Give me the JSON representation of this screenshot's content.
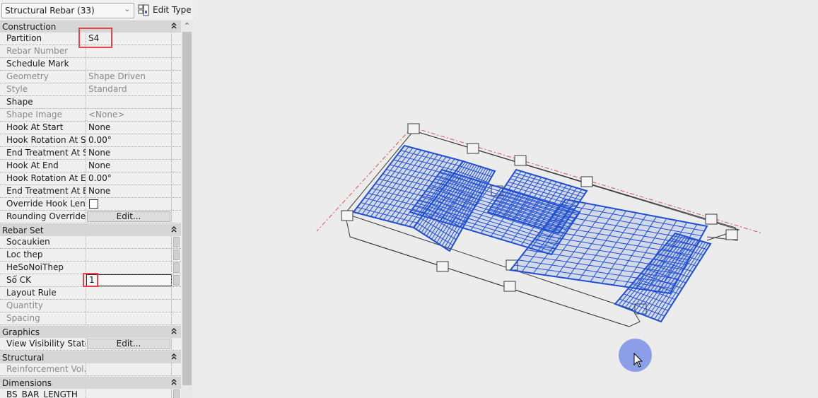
{
  "properties_panel": {
    "type_selector": {
      "value": "Structural Rebar (33)",
      "icon": "chevron-down-icon"
    },
    "edit_type": {
      "label": "Edit Type",
      "icon": "edit-type-icon"
    },
    "groups": [
      {
        "title": "Construction",
        "rows": [
          {
            "name": "Partition",
            "value": "S4",
            "dim": false,
            "highlighted": true
          },
          {
            "name": "Rebar Number",
            "value": "",
            "dim": true
          },
          {
            "name": "Schedule Mark",
            "value": "",
            "dim": false
          },
          {
            "name": "Geometry",
            "value": "Shape Driven",
            "dim": true
          },
          {
            "name": "Style",
            "value": "Standard",
            "dim": true
          },
          {
            "name": "Shape",
            "value": "",
            "dim": false
          },
          {
            "name": "Shape Image",
            "value": "<None>",
            "dim": true
          },
          {
            "name": "Hook At Start",
            "value": "None",
            "dim": false
          },
          {
            "name": "Hook Rotation At S...",
            "value": "0.00°",
            "dim": false
          },
          {
            "name": "End Treatment At S...",
            "value": "None",
            "dim": false
          },
          {
            "name": "Hook At End",
            "value": "None",
            "dim": false
          },
          {
            "name": "Hook Rotation At E...",
            "value": "0.00°",
            "dim": false
          },
          {
            "name": "End Treatment At E...",
            "value": "None",
            "dim": false
          },
          {
            "name": "Override Hook Len...",
            "value": "",
            "control": "checkbox",
            "checked": false
          },
          {
            "name": "Rounding Overrides",
            "value": "Edit...",
            "control": "button"
          }
        ]
      },
      {
        "title": "Rebar Set",
        "rows": [
          {
            "name": "Socaukien",
            "value": "",
            "dim": false,
            "gutter_button": true
          },
          {
            "name": "Loc thep",
            "value": "",
            "dim": false,
            "gutter_button": true
          },
          {
            "name": "HeSoNoiThep",
            "value": "",
            "dim": false,
            "gutter_button": true
          },
          {
            "name": "Số CK",
            "value": "1",
            "dim": false,
            "control": "input",
            "highlighted": true,
            "gutter_button": true
          },
          {
            "name": "Layout Rule",
            "value": "",
            "dim": false
          },
          {
            "name": "Quantity",
            "value": "",
            "dim": true
          },
          {
            "name": "Spacing",
            "value": "",
            "dim": true
          }
        ]
      },
      {
        "title": "Graphics",
        "rows": [
          {
            "name": "View Visibility States",
            "value": "Edit...",
            "control": "button"
          }
        ]
      },
      {
        "title": "Structural",
        "rows": [
          {
            "name": "Reinforcement Vol...",
            "value": "",
            "dim": true
          }
        ]
      },
      {
        "title": "Dimensions",
        "rows": [
          {
            "name": "BS_BAR_LENGTH",
            "value": "",
            "dim": false,
            "gutter_button": true
          }
        ]
      }
    ],
    "collapse_icon": "double-chevron-up-icon"
  },
  "viewport": {
    "content": "3D view of slab with structural rebar",
    "colors": {
      "rebar": "#1f4fd0",
      "structure_edges": "#3a3a3a",
      "grid_line": "#d9534f",
      "cursor_highlight": "#6e84e8"
    }
  },
  "colors": {
    "highlight_box": "#e2444a",
    "group_header": "#d6d6d6",
    "panel_bg": "#efefef"
  }
}
